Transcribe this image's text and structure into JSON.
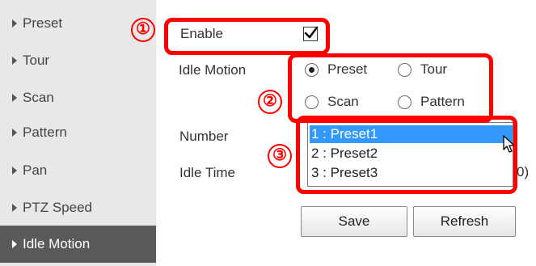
{
  "sidebar": {
    "items": [
      {
        "label": "Preset",
        "active": false
      },
      {
        "label": "Tour",
        "active": false
      },
      {
        "label": "Scan",
        "active": false
      },
      {
        "label": "Pattern",
        "active": false
      },
      {
        "label": "Pan",
        "active": false
      },
      {
        "label": "PTZ Speed",
        "active": false
      },
      {
        "label": "Idle Motion",
        "active": true
      }
    ]
  },
  "form": {
    "enable": {
      "label": "Enable",
      "checked": true
    },
    "idle_motion": {
      "label": "Idle Motion",
      "options": [
        {
          "label": "Preset",
          "selected": true
        },
        {
          "label": "Tour",
          "selected": false
        },
        {
          "label": "Scan",
          "selected": false
        },
        {
          "label": "Pattern",
          "selected": false
        }
      ]
    },
    "number": {
      "label": "Number",
      "options": [
        "1 : Preset1",
        "2 : Preset2",
        "3 : Preset3"
      ],
      "selected": "1 : Preset1"
    },
    "idle_time": {
      "label": "Idle Time",
      "clipped_suffix": "0)"
    }
  },
  "buttons": {
    "save": "Save",
    "refresh": "Refresh"
  },
  "annotations": {
    "markers": [
      "①",
      "②",
      "③"
    ],
    "color": "#ff0000"
  },
  "colors": {
    "sidebar_bg": "#e8e8e8",
    "active_bg": "#5a5a5a",
    "selection": "#3399ff"
  }
}
